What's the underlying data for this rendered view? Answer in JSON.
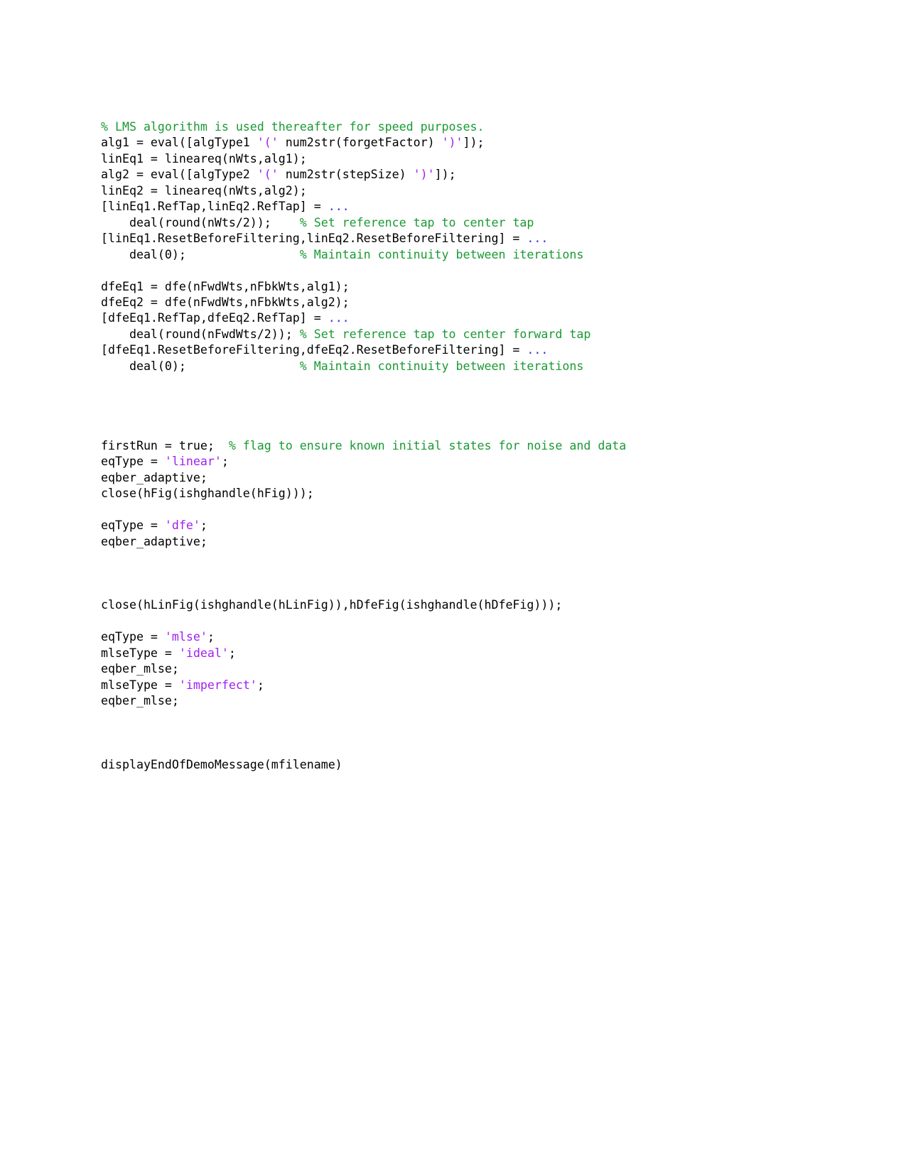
{
  "document": {
    "type": "matlab-code-listing",
    "background_color": "#ffffff",
    "colors": {
      "plain": "#000000",
      "comment": "#1a9a33",
      "string": "#a020f0",
      "continuation": "#3333cc"
    }
  },
  "code": {
    "language": "matlab",
    "lines": [
      {
        "index": 0,
        "tokens": [
          {
            "t": "comment",
            "s": "% LMS algorithm is used thereafter for speed purposes."
          }
        ]
      },
      {
        "index": 1,
        "tokens": [
          {
            "t": "plain",
            "s": "alg1 = eval([algType1 "
          },
          {
            "t": "string",
            "s": "'('"
          },
          {
            "t": "plain",
            "s": " num2str(forgetFactor) "
          },
          {
            "t": "string",
            "s": "')'"
          },
          {
            "t": "plain",
            "s": "]);"
          }
        ]
      },
      {
        "index": 2,
        "tokens": [
          {
            "t": "plain",
            "s": "linEq1 = lineareq(nWts,alg1);"
          }
        ]
      },
      {
        "index": 3,
        "tokens": [
          {
            "t": "plain",
            "s": "alg2 = eval([algType2 "
          },
          {
            "t": "string",
            "s": "'('"
          },
          {
            "t": "plain",
            "s": " num2str(stepSize) "
          },
          {
            "t": "string",
            "s": "')'"
          },
          {
            "t": "plain",
            "s": "]);"
          }
        ]
      },
      {
        "index": 4,
        "tokens": [
          {
            "t": "plain",
            "s": "linEq2 = lineareq(nWts,alg2);"
          }
        ]
      },
      {
        "index": 5,
        "tokens": [
          {
            "t": "plain",
            "s": "[linEq1.RefTap,linEq2.RefTap] = "
          },
          {
            "t": "cont",
            "s": "..."
          }
        ]
      },
      {
        "index": 6,
        "tokens": [
          {
            "t": "plain",
            "s": "    deal(round(nWts/2));    "
          },
          {
            "t": "comment",
            "s": "% Set reference tap to center tap"
          }
        ]
      },
      {
        "index": 7,
        "tokens": [
          {
            "t": "plain",
            "s": "[linEq1.ResetBeforeFiltering,linEq2.ResetBeforeFiltering] = "
          },
          {
            "t": "cont",
            "s": "..."
          }
        ]
      },
      {
        "index": 8,
        "tokens": [
          {
            "t": "plain",
            "s": "    deal(0);                "
          },
          {
            "t": "comment",
            "s": "% Maintain continuity between iterations"
          }
        ]
      },
      {
        "index": 9,
        "tokens": []
      },
      {
        "index": 10,
        "tokens": [
          {
            "t": "plain",
            "s": "dfeEq1 = dfe(nFwdWts,nFbkWts,alg1);"
          }
        ]
      },
      {
        "index": 11,
        "tokens": [
          {
            "t": "plain",
            "s": "dfeEq2 = dfe(nFwdWts,nFbkWts,alg2);"
          }
        ]
      },
      {
        "index": 12,
        "tokens": [
          {
            "t": "plain",
            "s": "[dfeEq1.RefTap,dfeEq2.RefTap] = "
          },
          {
            "t": "cont",
            "s": "..."
          }
        ]
      },
      {
        "index": 13,
        "tokens": [
          {
            "t": "plain",
            "s": "    deal(round(nFwdWts/2)); "
          },
          {
            "t": "comment",
            "s": "% Set reference tap to center forward tap"
          }
        ]
      },
      {
        "index": 14,
        "tokens": [
          {
            "t": "plain",
            "s": "[dfeEq1.ResetBeforeFiltering,dfeEq2.ResetBeforeFiltering] = "
          },
          {
            "t": "cont",
            "s": "..."
          }
        ]
      },
      {
        "index": 15,
        "tokens": [
          {
            "t": "plain",
            "s": "    deal(0);                "
          },
          {
            "t": "comment",
            "s": "% Maintain continuity between iterations"
          }
        ]
      },
      {
        "index": 16,
        "tokens": []
      },
      {
        "index": 17,
        "tokens": []
      },
      {
        "index": 18,
        "tokens": []
      },
      {
        "index": 19,
        "tokens": []
      },
      {
        "index": 20,
        "tokens": [
          {
            "t": "plain",
            "s": "firstRun = true;  "
          },
          {
            "t": "comment",
            "s": "% flag to ensure known initial states for noise and data"
          }
        ]
      },
      {
        "index": 21,
        "tokens": [
          {
            "t": "plain",
            "s": "eqType = "
          },
          {
            "t": "string",
            "s": "'linear'"
          },
          {
            "t": "plain",
            "s": ";"
          }
        ]
      },
      {
        "index": 22,
        "tokens": [
          {
            "t": "plain",
            "s": "eqber_adaptive;"
          }
        ]
      },
      {
        "index": 23,
        "tokens": [
          {
            "t": "plain",
            "s": "close(hFig(ishghandle(hFig)));"
          }
        ]
      },
      {
        "index": 24,
        "tokens": []
      },
      {
        "index": 25,
        "tokens": [
          {
            "t": "plain",
            "s": "eqType = "
          },
          {
            "t": "string",
            "s": "'dfe'"
          },
          {
            "t": "plain",
            "s": ";"
          }
        ]
      },
      {
        "index": 26,
        "tokens": [
          {
            "t": "plain",
            "s": "eqber_adaptive;"
          }
        ]
      },
      {
        "index": 27,
        "tokens": []
      },
      {
        "index": 28,
        "tokens": []
      },
      {
        "index": 29,
        "tokens": []
      },
      {
        "index": 30,
        "tokens": [
          {
            "t": "plain",
            "s": "close(hLinFig(ishghandle(hLinFig)),hDfeFig(ishghandle(hDfeFig)));"
          }
        ]
      },
      {
        "index": 31,
        "tokens": []
      },
      {
        "index": 32,
        "tokens": [
          {
            "t": "plain",
            "s": "eqType = "
          },
          {
            "t": "string",
            "s": "'mlse'"
          },
          {
            "t": "plain",
            "s": ";"
          }
        ]
      },
      {
        "index": 33,
        "tokens": [
          {
            "t": "plain",
            "s": "mlseType = "
          },
          {
            "t": "string",
            "s": "'ideal'"
          },
          {
            "t": "plain",
            "s": ";"
          }
        ]
      },
      {
        "index": 34,
        "tokens": [
          {
            "t": "plain",
            "s": "eqber_mlse;"
          }
        ]
      },
      {
        "index": 35,
        "tokens": [
          {
            "t": "plain",
            "s": "mlseType = "
          },
          {
            "t": "string",
            "s": "'imperfect'"
          },
          {
            "t": "plain",
            "s": ";"
          }
        ]
      },
      {
        "index": 36,
        "tokens": [
          {
            "t": "plain",
            "s": "eqber_mlse;"
          }
        ]
      },
      {
        "index": 37,
        "tokens": []
      },
      {
        "index": 38,
        "tokens": []
      },
      {
        "index": 39,
        "tokens": []
      },
      {
        "index": 40,
        "tokens": [
          {
            "t": "plain",
            "s": "displayEndOfDemoMessage(mfilename)"
          }
        ]
      }
    ]
  }
}
